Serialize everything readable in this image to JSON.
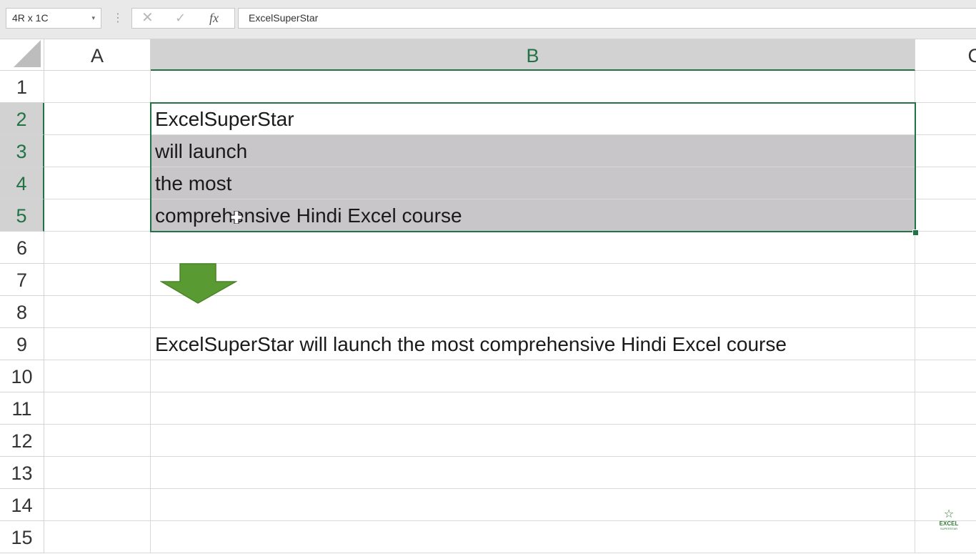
{
  "formula_bar": {
    "name_box": "4R x 1C",
    "name_box_dropdown": "▾",
    "menu_dots": "⋮",
    "cancel_glyph": "✕",
    "enter_glyph": "✓",
    "fx_glyph": "fx",
    "formula_value": "ExcelSuperStar"
  },
  "columns": [
    "A",
    "B",
    "C"
  ],
  "rows": [
    {
      "num": "1",
      "b": ""
    },
    {
      "num": "2",
      "b": "ExcelSuperStar"
    },
    {
      "num": "3",
      "b": "will launch"
    },
    {
      "num": "4",
      "b": "the most"
    },
    {
      "num": "5",
      "b": "comprehensive Hindi Excel course"
    },
    {
      "num": "6",
      "b": ""
    },
    {
      "num": "7",
      "b": ""
    },
    {
      "num": "8",
      "b": ""
    },
    {
      "num": "9",
      "b": "ExcelSuperStar will launch the most comprehensive Hindi Excel course"
    },
    {
      "num": "10",
      "b": ""
    },
    {
      "num": "11",
      "b": ""
    },
    {
      "num": "12",
      "b": ""
    },
    {
      "num": "13",
      "b": ""
    },
    {
      "num": "14",
      "b": ""
    },
    {
      "num": "15",
      "b": ""
    }
  ],
  "selection": {
    "range": "B2:B5",
    "shaded_rows": [
      "3",
      "4",
      "5"
    ]
  },
  "logo": {
    "text_line1": "EXCEL",
    "text_line2": "SUPERSTAR"
  },
  "colors": {
    "accent": "#217346",
    "arrow": "#5a9a32",
    "selected_fill": "#c8c6c8"
  }
}
